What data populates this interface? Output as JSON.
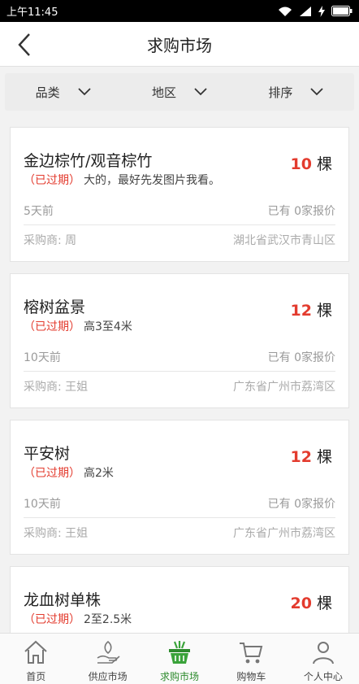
{
  "status_bar": {
    "time": "上午11:45"
  },
  "header": {
    "title": "求购市场"
  },
  "filters": [
    {
      "label": "品类"
    },
    {
      "label": "地区"
    },
    {
      "label": "排序"
    }
  ],
  "listings": [
    {
      "name": "金边棕竹/观音棕竹",
      "qty": "10",
      "unit": "棵",
      "status": "（已过期）",
      "desc": "大的，最好先发图片我看。",
      "time": "5天前",
      "quotes": "已有 0家报价",
      "buyer": "采购商: 周",
      "location": "湖北省武汉市青山区"
    },
    {
      "name": "榕树盆景",
      "qty": "12",
      "unit": "棵",
      "status": "（已过期）",
      "desc": "高3至4米",
      "time": "10天前",
      "quotes": "已有 0家报价",
      "buyer": "采购商: 王姐",
      "location": "广东省广州市荔湾区"
    },
    {
      "name": "平安树",
      "qty": "12",
      "unit": "棵",
      "status": "（已过期）",
      "desc": "高2米",
      "time": "10天前",
      "quotes": "已有 0家报价",
      "buyer": "采购商: 王姐",
      "location": "广东省广州市荔湾区"
    },
    {
      "name": "龙血树单株",
      "qty": "20",
      "unit": "棵",
      "status": "（已过期）",
      "desc": "2至2.5米"
    }
  ],
  "tabs": [
    {
      "label": "首页",
      "icon": "home-icon"
    },
    {
      "label": "供应市场",
      "icon": "supply-hand-icon"
    },
    {
      "label": "求购市场",
      "icon": "basket-icon",
      "active": true
    },
    {
      "label": "购物车",
      "icon": "cart-icon"
    },
    {
      "label": "个人中心",
      "icon": "user-icon"
    }
  ],
  "colors": {
    "accent_red": "#e33b2e",
    "active_green": "#2e8b2e",
    "status_bar_bg": "#000000"
  }
}
